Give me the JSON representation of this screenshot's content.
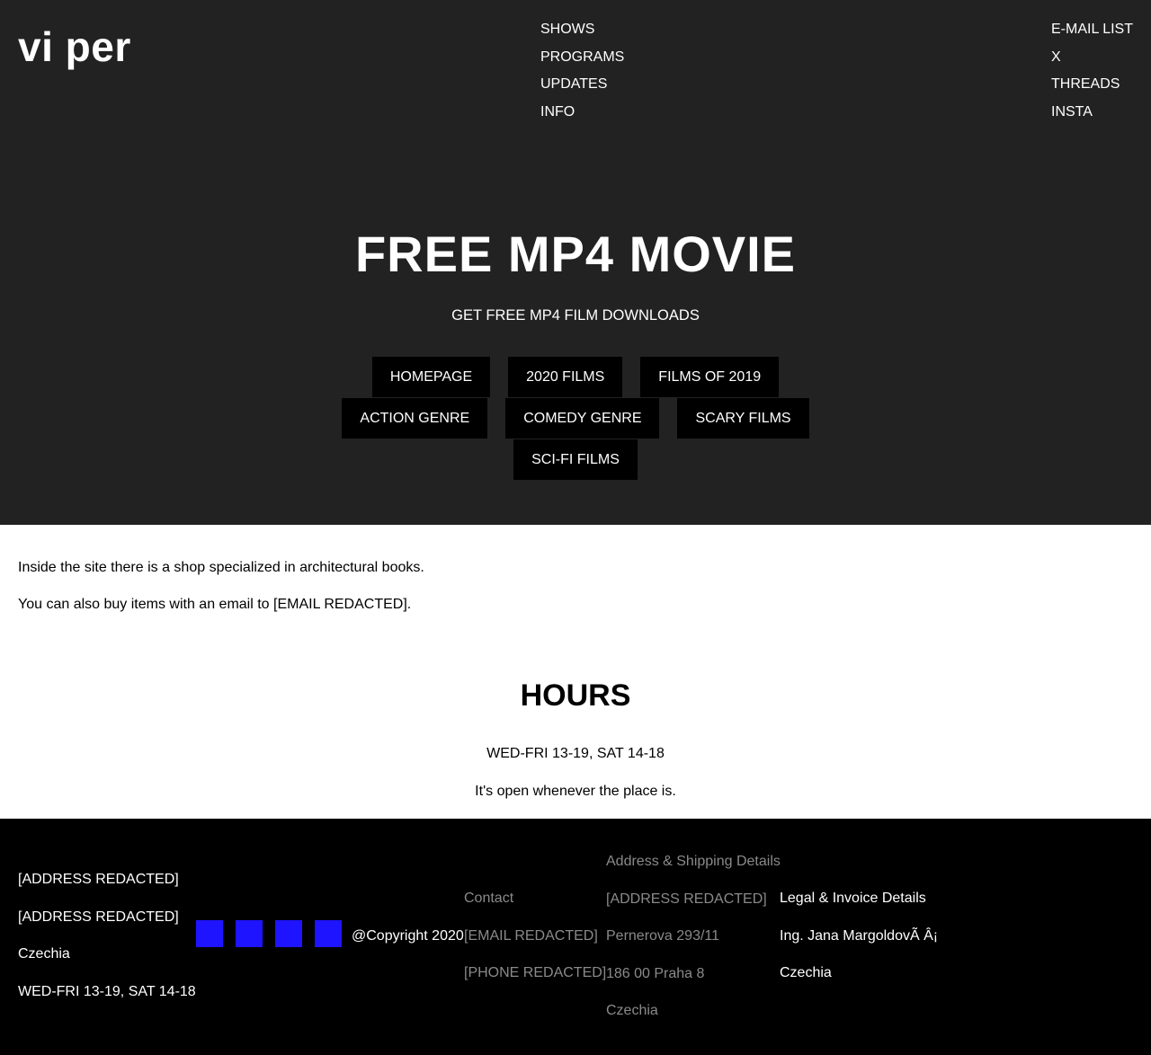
{
  "header": {
    "logo": "vi per",
    "nav_main": [
      "SHOWS",
      "PROGRAMS",
      "UPDATES",
      "INFO"
    ],
    "nav_social": [
      "E-MAIL LIST",
      "X",
      "THREADS",
      "INSTA"
    ]
  },
  "hero": {
    "title": "FREE MP4 MOVIE",
    "subtitle": "GET FREE MP4 FILM DOWNLOADS",
    "buttons": [
      "HOMEPAGE",
      "2020 FILMS",
      "FILMS OF 2019",
      "ACTION GENRE",
      "COMEDY GENRE",
      "SCARY FILMS",
      "SCI-FI FILMS"
    ]
  },
  "intro": {
    "line1": "Inside the site there is a shop specialized in architectural books.",
    "line2": "You can also buy items with an email to [EMAIL REDACTED]."
  },
  "hours": {
    "title": "HOURS",
    "schedule": "WED-FRI 13-19, SAT 14-18",
    "note": "It's open whenever the place is."
  },
  "footer": {
    "address": [
      "[ADDRESS REDACTED]",
      "[ADDRESS REDACTED]",
      "Czechia",
      "WED-FRI 13-19, SAT 14-18"
    ],
    "social_icons": [
      "social-icon-1",
      "social-icon-2",
      "social-icon-3",
      "social-icon-4"
    ],
    "icon_color": "#1f14ff",
    "copyright": "@Copyright 2020",
    "contact": [
      "Contact",
      "[EMAIL REDACTED]",
      "[PHONE REDACTED]"
    ],
    "shipping": [
      "Address & Shipping Details",
      "[ADDRESS REDACTED]",
      "Pernerova 293/11",
      "186 00 Praha 8",
      "Czechia"
    ],
    "legal": [
      "Legal & Invoice Details",
      "Ing. Jana MargoldovÃ   Â¡",
      "Czechia"
    ]
  }
}
